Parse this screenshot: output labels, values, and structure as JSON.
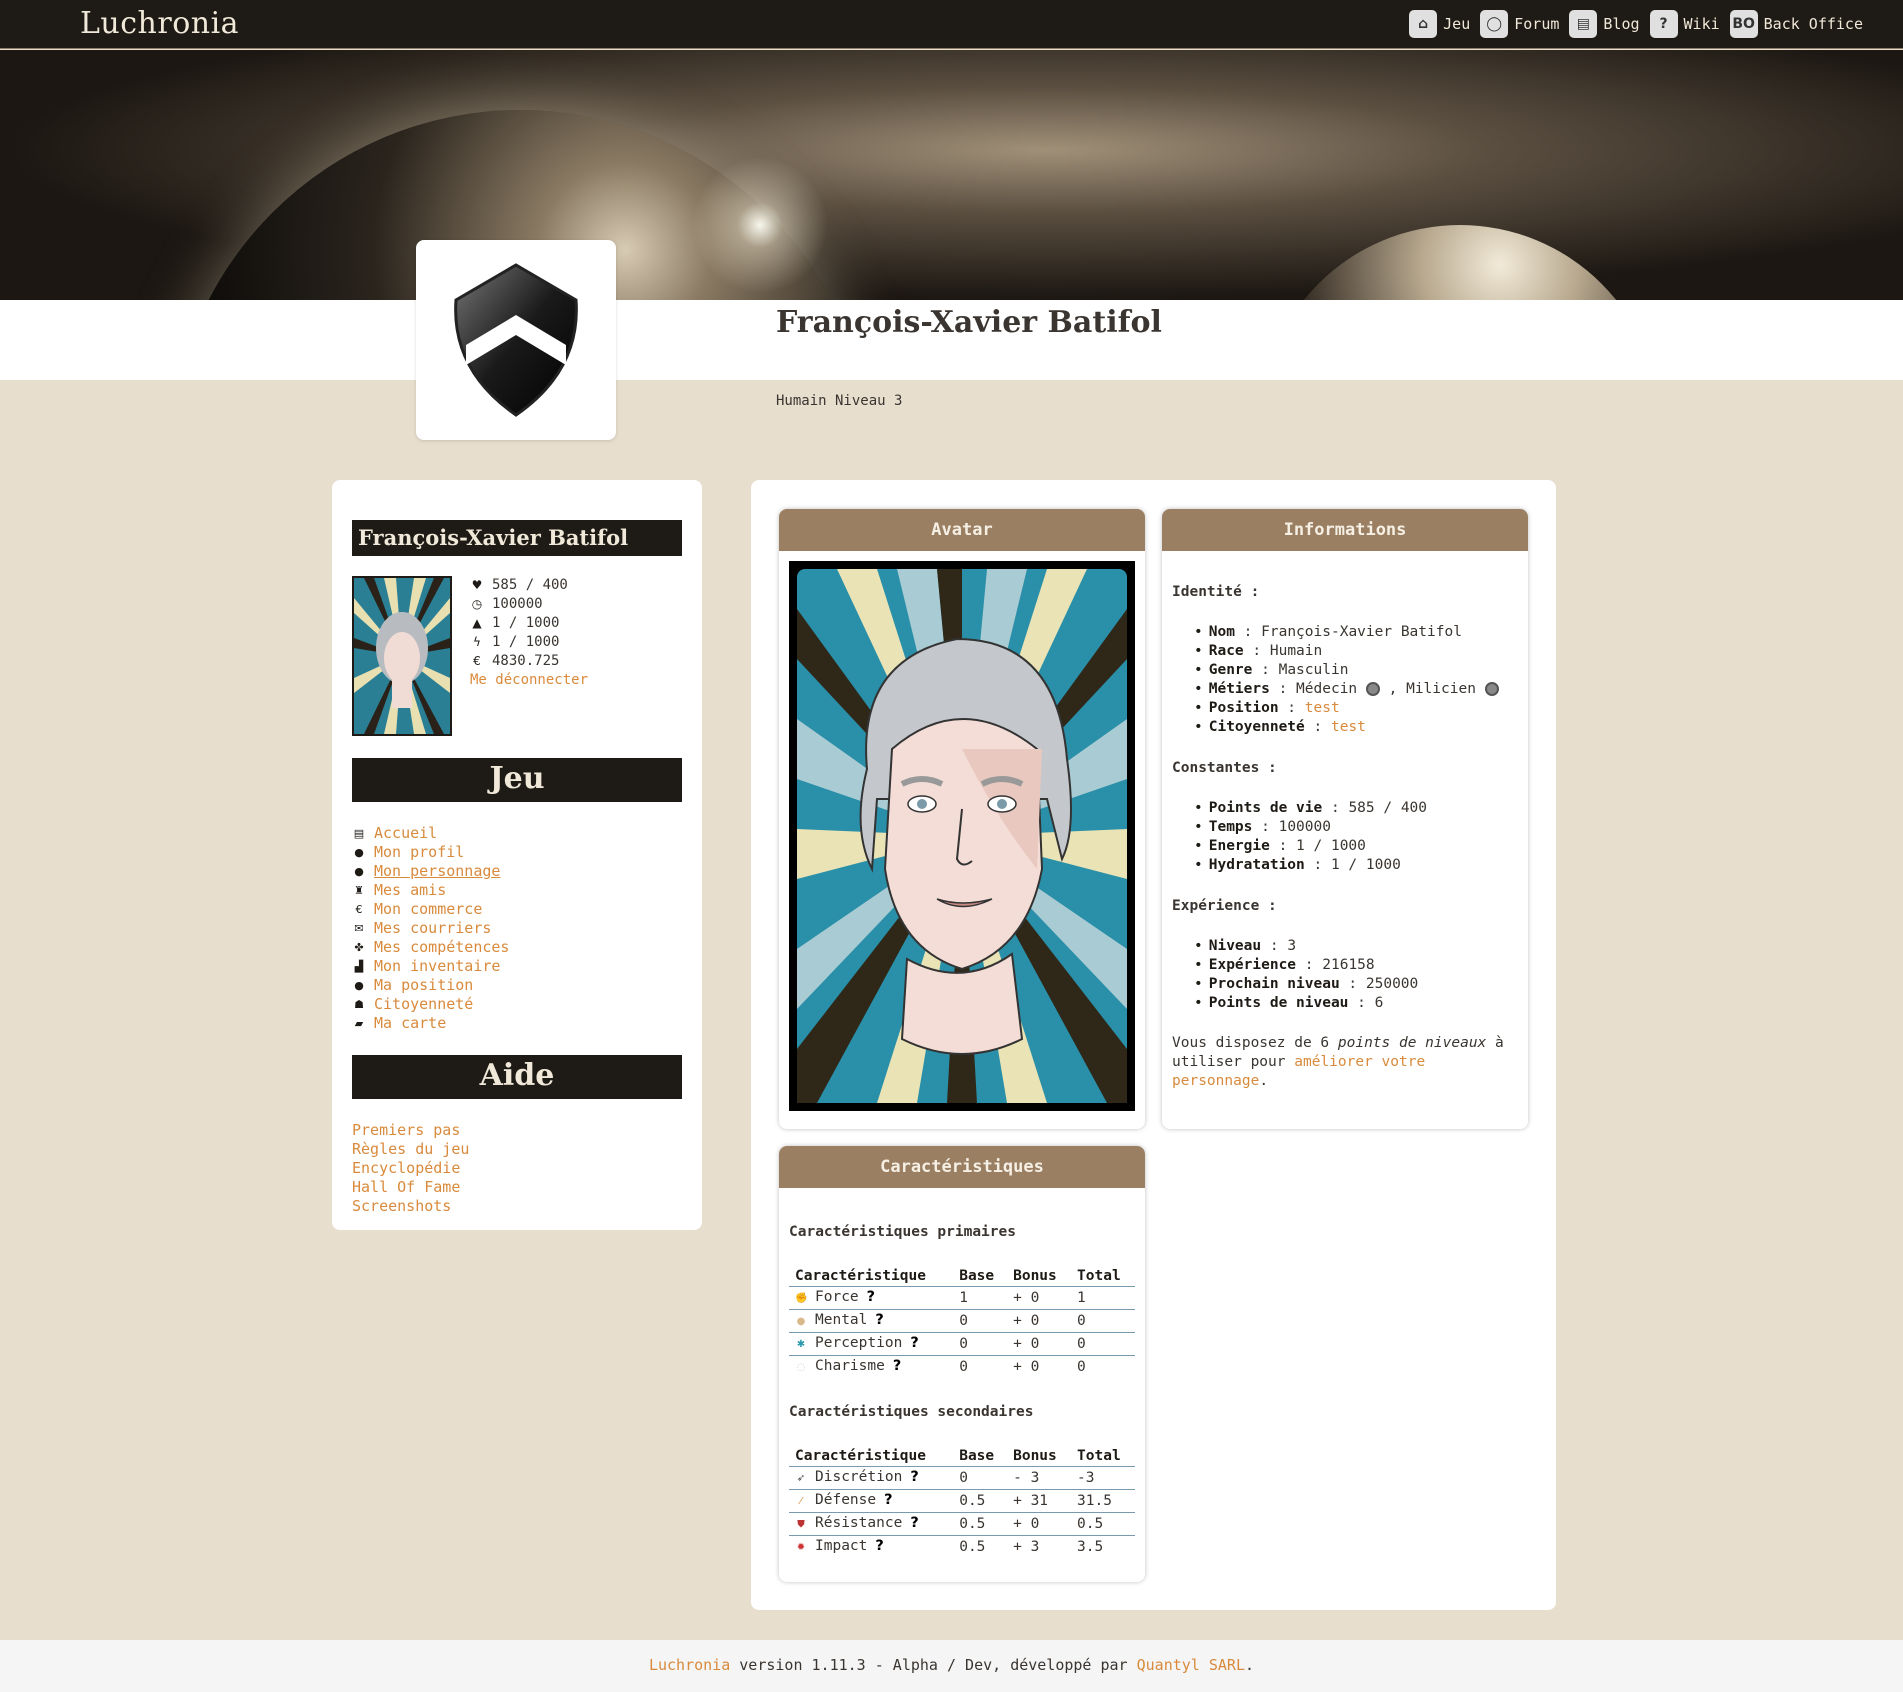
{
  "header": {
    "logo": "Luchronia",
    "nav": [
      {
        "icon": "home-icon",
        "label": "Jeu"
      },
      {
        "icon": "speech-bubble-icon",
        "label": "Forum"
      },
      {
        "icon": "book-icon",
        "label": "Blog"
      },
      {
        "icon": "question-icon",
        "label": "Wiki"
      },
      {
        "icon": "bo-icon",
        "label": "Back Office",
        "glyph": "BO"
      }
    ]
  },
  "profile": {
    "name": "François-Xavier Batifol",
    "subtitle": "Humain Niveau 3"
  },
  "sidebar": {
    "name": "François-Xavier Batifol",
    "stats": [
      {
        "icon": "heart-icon",
        "value": "585 / 400"
      },
      {
        "icon": "clock-icon",
        "value": "100000"
      },
      {
        "icon": "drop-icon",
        "value": "1 / 1000"
      },
      {
        "icon": "lightning-icon",
        "value": "1 / 1000"
      },
      {
        "icon": "euro-icon",
        "value": "4830.725"
      }
    ],
    "logout": "Me déconnecter",
    "game_title": "Jeu",
    "menu": [
      {
        "icon": "list-icon",
        "label": "Accueil"
      },
      {
        "icon": "person-icon",
        "label": "Mon profil"
      },
      {
        "icon": "person-icon",
        "label": "Mon personnage"
      },
      {
        "icon": "friends-icon",
        "label": "Mes amis"
      },
      {
        "icon": "euro-icon",
        "label": "Mon commerce"
      },
      {
        "icon": "envelope-icon",
        "label": "Mes courriers"
      },
      {
        "icon": "skills-icon",
        "label": "Mes compétences"
      },
      {
        "icon": "bag-icon",
        "label": "Mon inventaire"
      },
      {
        "icon": "pin-icon",
        "label": "Ma position"
      },
      {
        "icon": "citizen-icon",
        "label": "Citoyenneté"
      },
      {
        "icon": "map-icon",
        "label": "Ma carte"
      }
    ],
    "help_title": "Aide",
    "help_links": [
      "Premiers pas",
      "Règles du jeu",
      "Encyclopédie",
      "Hall Of Fame",
      "Screenshots"
    ]
  },
  "avatar_card": {
    "title": "Avatar"
  },
  "info_card": {
    "title": "Informations",
    "identity_title": "Identité :",
    "identity": {
      "nom_label": "Nom",
      "nom": "François-Xavier Batifol",
      "race_label": "Race",
      "race": "Humain",
      "genre_label": "Genre",
      "genre": "Masculin",
      "metiers_label": "Métiers",
      "metier1": "Médecin",
      "metier2": "Milicien",
      "position_label": "Position",
      "position": "test",
      "citoyennete_label": "Citoyenneté",
      "citoyennete": "test"
    },
    "constants_title": "Constantes :",
    "constants": [
      {
        "label": "Points de vie",
        "value": "585 / 400"
      },
      {
        "label": "Temps",
        "value": "100000"
      },
      {
        "label": "Energie",
        "value": "1 / 1000"
      },
      {
        "label": "Hydratation",
        "value": "1 / 1000"
      }
    ],
    "xp_title": "Expérience :",
    "xp": [
      {
        "label": "Niveau",
        "value": "3"
      },
      {
        "label": "Expérience",
        "value": "216158"
      },
      {
        "label": "Prochain niveau",
        "value": "250000"
      },
      {
        "label": "Points de niveau",
        "value": "6"
      }
    ],
    "note_prefix": "Vous disposez de 6",
    "note_em": "points de niveaux",
    "note_mid": "à utiliser pour",
    "note_link": "améliorer votre personnage",
    "note_end": "."
  },
  "carac_card": {
    "title": "Caractéristiques",
    "primary_title": "Caractéristiques primaires",
    "secondary_title": "Caractéristiques secondaires",
    "headers": [
      "Caractéristique",
      "Base",
      "Bonus",
      "Total"
    ],
    "primary": [
      {
        "icon": "fist-icon",
        "name": "Force",
        "base": "1",
        "bonus": "+ 0",
        "total": "1"
      },
      {
        "icon": "brain-icon",
        "name": "Mental",
        "base": "0",
        "bonus": "+ 0",
        "total": "0"
      },
      {
        "icon": "eye-icon",
        "name": "Perception",
        "base": "0",
        "bonus": "+ 0",
        "total": "0"
      },
      {
        "icon": "speech-icon",
        "name": "Charisme",
        "base": "0",
        "bonus": "+ 0",
        "total": "0"
      }
    ],
    "secondary": [
      {
        "icon": "feather-icon",
        "name": "Discrétion",
        "base": "0",
        "bonus": "- 3",
        "total": "-3"
      },
      {
        "icon": "sword-icon",
        "name": "Défense",
        "base": "0.5",
        "bonus": "+ 31",
        "total": "31.5"
      },
      {
        "icon": "shield-icon",
        "name": "Résistance",
        "base": "0.5",
        "bonus": "+ 0",
        "total": "0.5"
      },
      {
        "icon": "impact-icon",
        "name": "Impact",
        "base": "0.5",
        "bonus": "+ 3",
        "total": "3.5"
      }
    ]
  },
  "footer": {
    "brand": "Luchronia",
    "text": " version 1.11.3 - Alpha / Dev, développé par ",
    "company": "Quantyl SARL",
    "end": "."
  },
  "colors": {
    "accent": "#d98a3c",
    "dark": "#1e1a15",
    "card_head": "#9a7f63",
    "background": "#e8dece"
  }
}
